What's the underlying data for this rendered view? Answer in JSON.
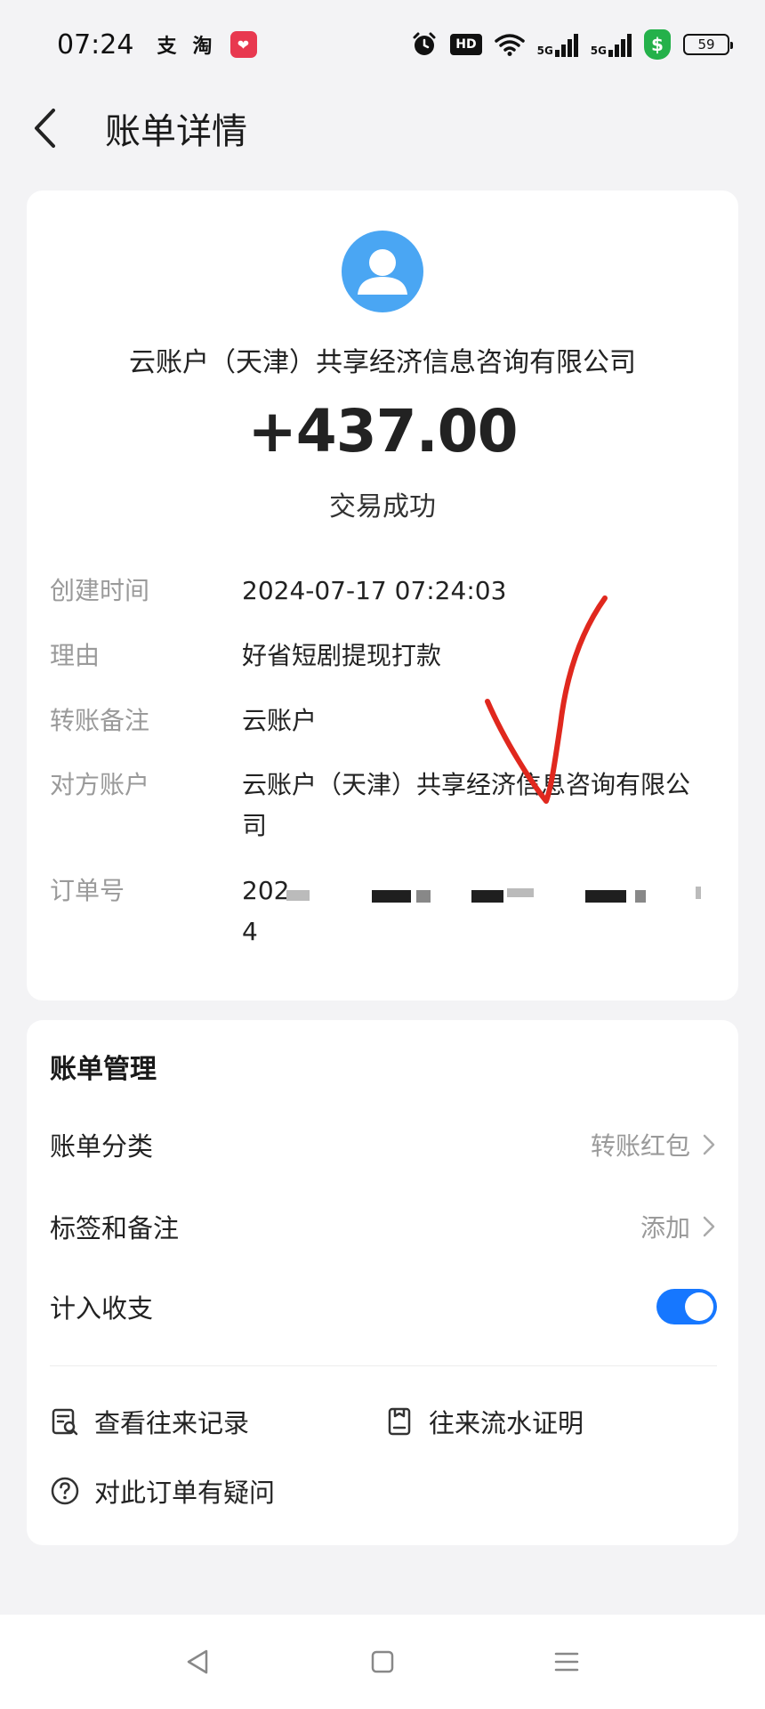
{
  "status_bar": {
    "time": "07:24",
    "app_indicators": [
      "支",
      "淘"
    ],
    "badge_icon": "heart-app-icon",
    "icons": [
      "alarm-icon",
      "hd-icon",
      "wifi-icon",
      "signal-5g-icon",
      "signal-5g-icon",
      "shield-icon",
      "battery-icon"
    ],
    "hd_label": "HD",
    "signal_label": "5G",
    "shield_label": "$",
    "battery": "59"
  },
  "header": {
    "title": "账单详情",
    "back_icon": "chevron-left-icon"
  },
  "transaction": {
    "payer": "云账户（天津）共享经济信息咨询有限公司",
    "amount": "+437.00",
    "status": "交易成功",
    "details": [
      {
        "label": "创建时间",
        "value": "2024-07-17 07:24:03"
      },
      {
        "label": "理由",
        "value": "好省短剧提现打款"
      },
      {
        "label": "转账备注",
        "value": "云账户"
      },
      {
        "label": "对方账户",
        "value": "云账户（天津）共享经济信息咨询有限公司"
      },
      {
        "label": "订单号",
        "value_prefix": "202",
        "value_suffix": "4"
      }
    ]
  },
  "management": {
    "title": "账单管理",
    "rows": [
      {
        "label": "账单分类",
        "value": "转账红包"
      },
      {
        "label": "标签和备注",
        "value": "添加"
      },
      {
        "label": "计入收支",
        "toggle_on": true
      }
    ],
    "links": [
      {
        "label": "查看往来记录",
        "icon": "record-search-icon"
      },
      {
        "label": "往来流水证明",
        "icon": "statement-icon"
      },
      {
        "label": "对此订单有疑问",
        "icon": "question-icon"
      }
    ]
  },
  "colors": {
    "accent": "#1677ff",
    "avatar": "#4aa6f3",
    "annotation": "#e0281e"
  }
}
